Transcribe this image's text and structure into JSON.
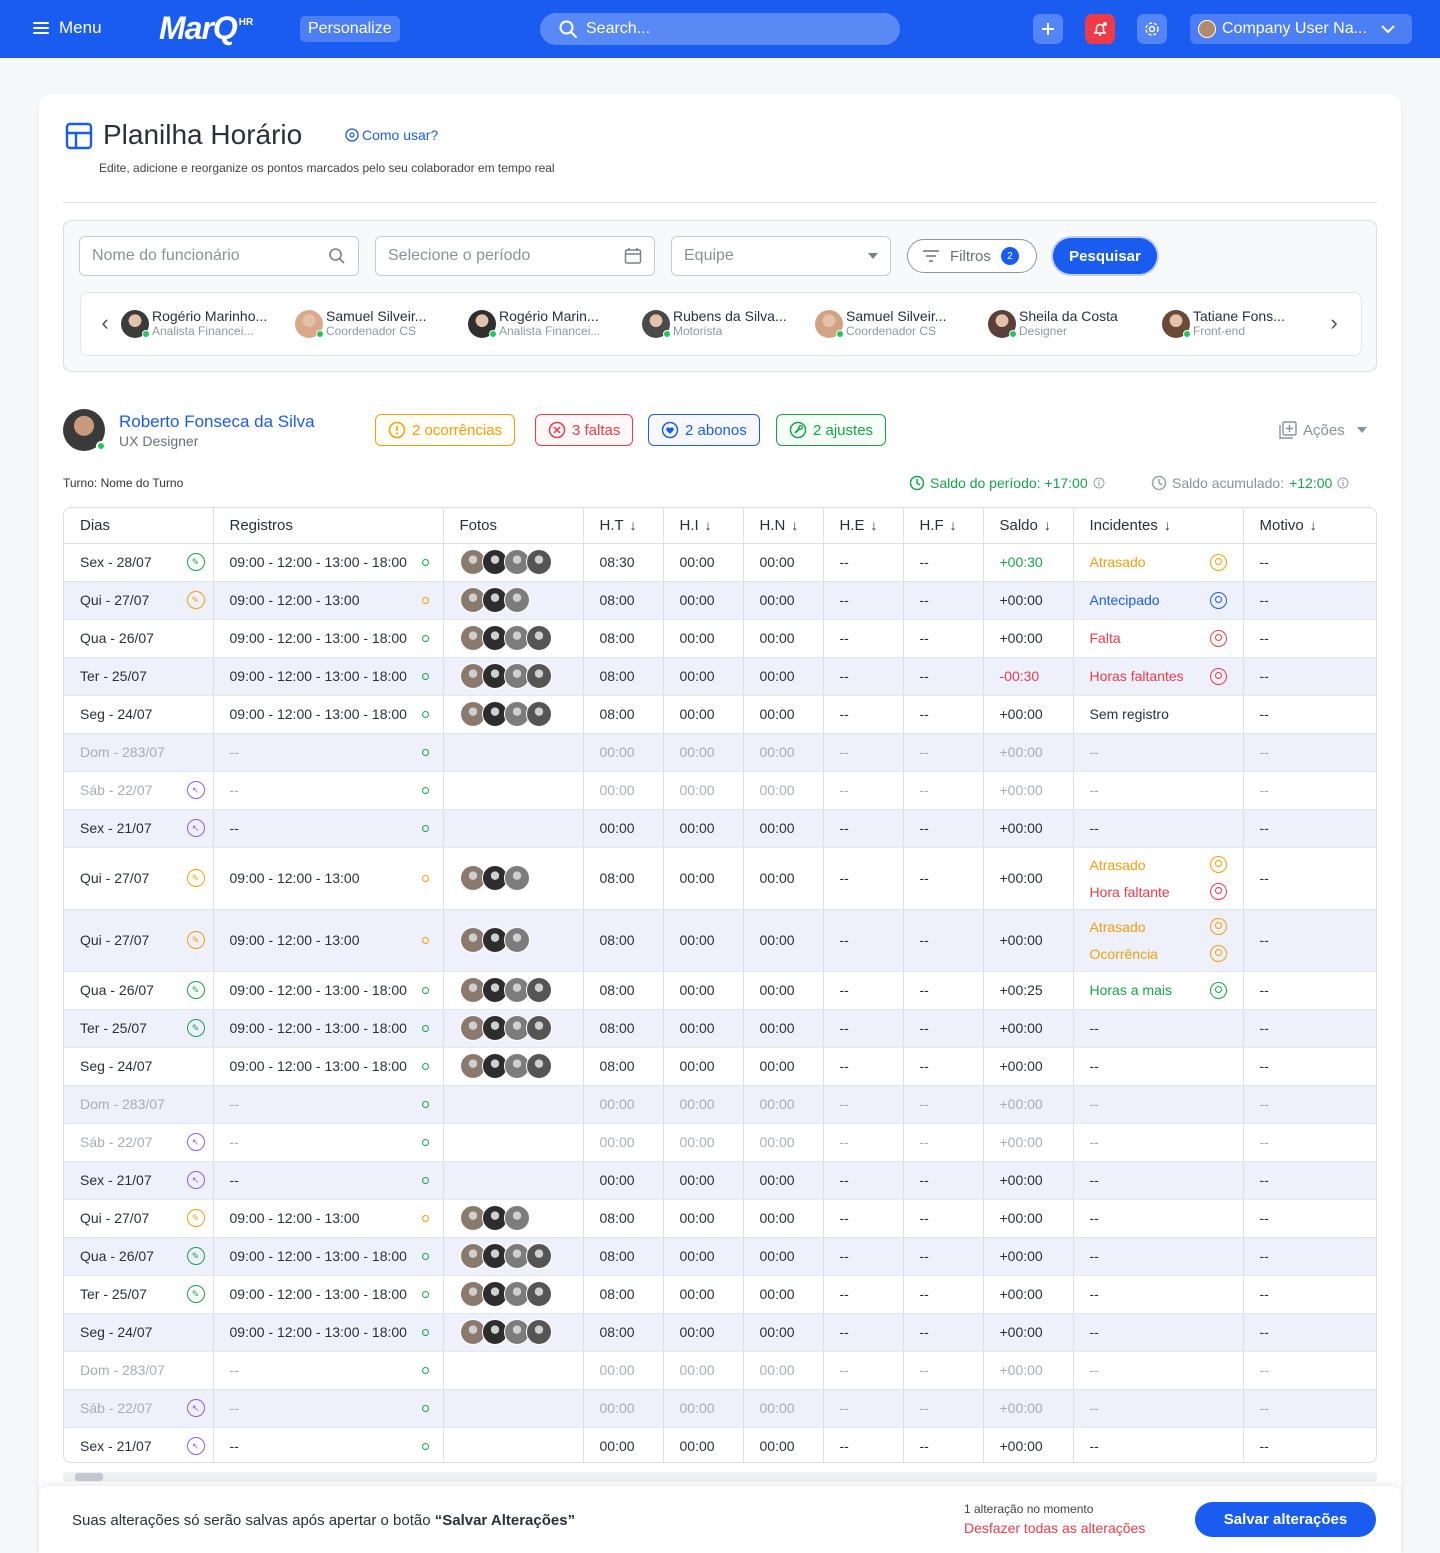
{
  "topbar": {
    "menu_label": "Menu",
    "logo": "MarQ",
    "logo_sup": "HR",
    "personalize_label": "Personalize",
    "search_placeholder": "Search...",
    "user_name": "Company User Na..."
  },
  "page": {
    "title": "Planilha Horário",
    "how_to": "Como usar?",
    "subtitle": "Edite, adicione e reorganize os pontos marcados pelo seu colaborador em tempo real"
  },
  "filters": {
    "employee_placeholder": "Nome do funcionário",
    "period_placeholder": "Selecione o período",
    "team_placeholder": "Equipe",
    "filters_label": "Filtros",
    "filters_count": "2",
    "search_label": "Pesquisar"
  },
  "employees": [
    {
      "name": "Rogério Marinho...",
      "role": "Analista Financei..."
    },
    {
      "name": "Samuel Silveir...",
      "role": "Coordenador CS"
    },
    {
      "name": "Rogério Marin...",
      "role": "Analista Financei..."
    },
    {
      "name": "Rubens da Silva...",
      "role": "Motorista"
    },
    {
      "name": "Samuel Silveir...",
      "role": "Coordenador CS"
    },
    {
      "name": "Sheila da Costa",
      "role": "Designer"
    },
    {
      "name": "Tatiane Fons...",
      "role": "Front-end"
    }
  ],
  "profile": {
    "name": "Roberto Fonseca da Silva",
    "role": "UX Designer",
    "ocorrencias": "2 ocorrências",
    "faltas": "3 faltas",
    "abonos": "2 abonos",
    "ajustes": "2 ajustes",
    "acoes": "Ações",
    "turno": "Turno: Nome do Turno",
    "saldo_periodo_label": "Saldo do período: +17:00",
    "saldo_acumulado_label": "Saldo acumulado:",
    "saldo_acumulado_value": "+12:00"
  },
  "table": {
    "headers": [
      "Dias",
      "Registros",
      "Fotos",
      "H.T",
      "H.I",
      "H.N",
      "H.E",
      "H.F",
      "Saldo",
      "Incidentes",
      "Motivo"
    ]
  },
  "footer": {
    "message": "Suas alterações só serão salvas após apertar o botão ",
    "message_bold": "“Salvar Alterações”",
    "alteration_count": "1 alteração no momento",
    "undo_label": "Desfazer todas as alterações",
    "save_label": "Salvar alterações"
  },
  "colors": {
    "primary": "#1a5cf0",
    "green": "#16a34a",
    "red": "#ee3b47",
    "orange": "#f59e0b",
    "purple": "#8b5cf6"
  }
}
